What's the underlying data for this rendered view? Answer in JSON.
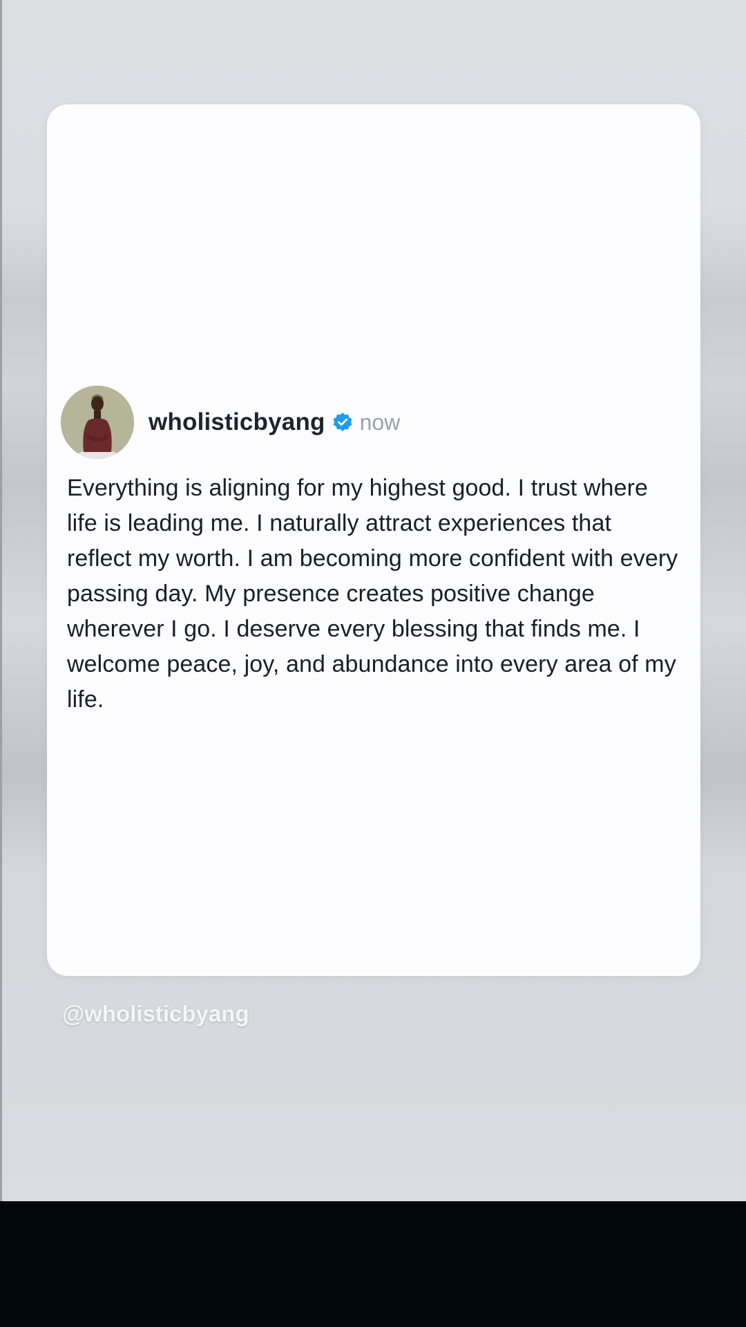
{
  "post": {
    "username": "wholisticbyang",
    "verified_icon": "verified-badge-icon",
    "timestamp": "now",
    "text": "Everything is aligning for my highest good. I trust where life is leading me. I naturally attract experiences that reflect my worth. I am becoming more confident with every passing day. My presence creates positive change wherever I go. I deserve every blessing that finds me. I welcome peace, joy, and abundance into every area of my life."
  },
  "watermark": {
    "handle": "@wholisticbyang"
  },
  "colors": {
    "verified": "#1d9bf0",
    "card_background": "#fdfcff",
    "backdrop": "#dadde1",
    "bottom_bar": "#02070b"
  }
}
